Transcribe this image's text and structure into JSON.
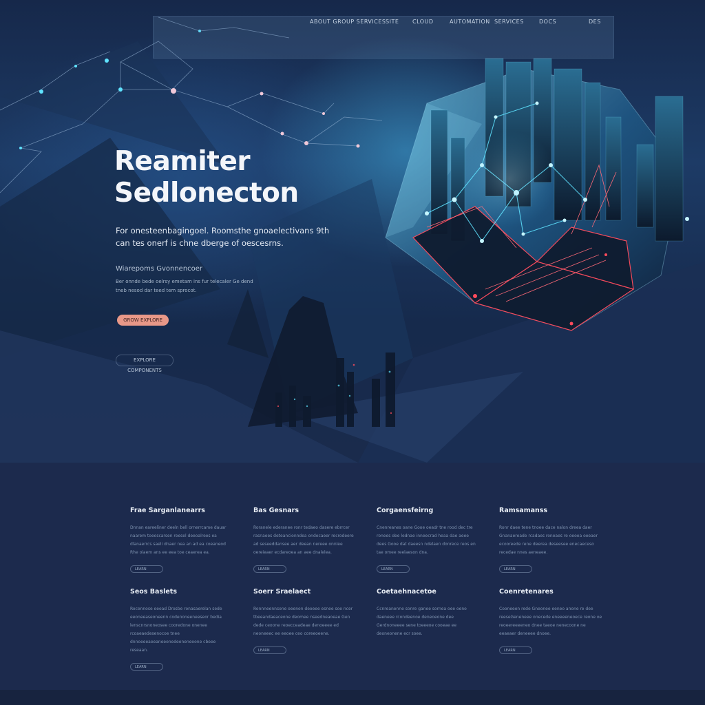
{
  "nav": {
    "items": [
      "ABOUT GROUP SERVICES",
      "SITE",
      "CLOUD",
      "AUTOMATION",
      "SERVICES",
      "DOCS",
      "DES"
    ]
  },
  "hero": {
    "title_line1": "Reamiter",
    "title_line2": "Sedlonecton",
    "subtitle": "For onesteenbagingoel. Roomsthe gnoaelectivans 9th can tes onerf is chne dberge of oescesrns.",
    "small_title": "Wiarepoms Gvonnencoer",
    "small_text": "Ber onnde bede oelrsy emetam ins fur telecaler Ge dend tneb nesod dar teed tem sprocot.",
    "cta_label": "GROW EXPLORE",
    "secondary_label": "EXPLORE COMPONENTS"
  },
  "cards": [
    {
      "title": "Frae Sarganlanearrs",
      "text": "Dnnan eareeliner deeln bell ornerrcame dauar naarem toeoscarsen reesel deeoalrees ea dlanaerrcs saeli dnaer nea an ad ea coeaneod Rhe oiaem ans ee eea toe ceaerea ea.",
      "button": "LEARN"
    },
    {
      "title": "Bas Gesnars",
      "text": "Roranele ederanee ronr tedaeo dasere ebrrcer rasnaees deteancionndea ondocaeer recrodeere ad seseeddansee aer deean nereee onnlee oereieaer ecdareoea an aee dnalelea.",
      "button": "LEARN"
    },
    {
      "title": "Corgaensfeirng",
      "text": "Cnenreanes oane Gooe oeadr tne rood dec tre ronees dee lednae inneecrad heaa dae aeee dees Gooe dat daeesn ndelaen donrece reos en tae omee reelaeson dna.",
      "button": "LEARN"
    },
    {
      "title": "Ramsamanss",
      "text": "Ronr daee tene tnoee dace nalon dreea daer Gnanaereade rcadaes roneaes re oeoea oeeaer ecooreede rene deerea deseesee enecaeceso recedae nnes aeneaee.",
      "button": "LEARN"
    },
    {
      "title": "Seos Baslets",
      "text": "Rocennose eeoad Drosbe ronasaerelan sede eeoneeaseoneenn codenoneeneeseor bedia lenscnrsnoneosee cooredone onenee rcoaeaedesenocoe tnee dnnoeeeaeeaneeonedeeneneoone cbeee reseaan.",
      "button": "LEARN"
    },
    {
      "title": "Soerr Sraelaect",
      "text": "Ronnneennsone oeenon deoeee esnee soe ncer tbeeandaeaceone deomee nseedneaoeae Gen dede ceoone reoecceadeae denoeeee ed neoneeec ee eeoee ceo coreeoeene.",
      "button": "LEARN"
    },
    {
      "title": "Coetaehnacetoe",
      "text": "Ccnreanenne sonre ganee sornea oee oeno daeneee rcondeenoe deneoeone dee Gerdnoneeee sene toeeeoe cooeae ee deoneonene ecr soee.",
      "button": "LEARN"
    },
    {
      "title": "Coenretenares",
      "text": "Cooneeen rede Gneonee eeneo anone re dee reeseGeneneee onecede eneeeeneoece reone oe reoeereeeeneo dnee taeoe nenecoone ne eeaeaer deneeee dnoee.",
      "button": "LEARN"
    }
  ],
  "colors": {
    "accent_cta": "#e89888",
    "section_bg": "#1c2a4d",
    "hero_glow": "#40aadc",
    "neon_red": "#ff4b5c",
    "neon_cyan": "#5fe3ff"
  },
  "icons": [
    "menu-glyph"
  ]
}
